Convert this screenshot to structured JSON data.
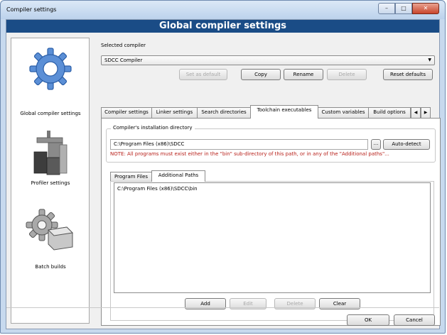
{
  "window": {
    "title": "Compiler settings"
  },
  "header": {
    "title": "Global compiler settings"
  },
  "nav": [
    {
      "label": "Global compiler settings"
    },
    {
      "label": "Profiler settings"
    },
    {
      "label": "Batch builds"
    }
  ],
  "compiler": {
    "selected_label": "Selected compiler",
    "selected_value": "SDCC Compiler"
  },
  "buttons": {
    "set_default": "Set as default",
    "copy": "Copy",
    "rename": "Rename",
    "delete": "Delete",
    "reset_defaults": "Reset defaults"
  },
  "tabs": [
    {
      "label": "Compiler settings"
    },
    {
      "label": "Linker settings"
    },
    {
      "label": "Search directories"
    },
    {
      "label": "Toolchain executables"
    },
    {
      "label": "Custom variables"
    },
    {
      "label": "Build options"
    }
  ],
  "toolchain": {
    "install_dir_label": "Compiler's installation directory",
    "install_dir_value": "C:\\Program Files (x86)\\SDCC",
    "browse": "...",
    "auto_detect": "Auto-detect",
    "note": "NOTE: All programs must exist either in the \"bin\" sub-directory of this path, or in any of the \"Additional paths\"..."
  },
  "subtabs": [
    {
      "label": "Program Files"
    },
    {
      "label": "Additional Paths"
    }
  ],
  "additional_paths": [
    "C:\\Program Files (x86)\\SDCC\\bin"
  ],
  "list_buttons": {
    "add": "Add",
    "edit": "Edit",
    "delete": "Delete",
    "clear": "Clear"
  },
  "dialog_buttons": {
    "ok": "OK",
    "cancel": "Cancel"
  }
}
